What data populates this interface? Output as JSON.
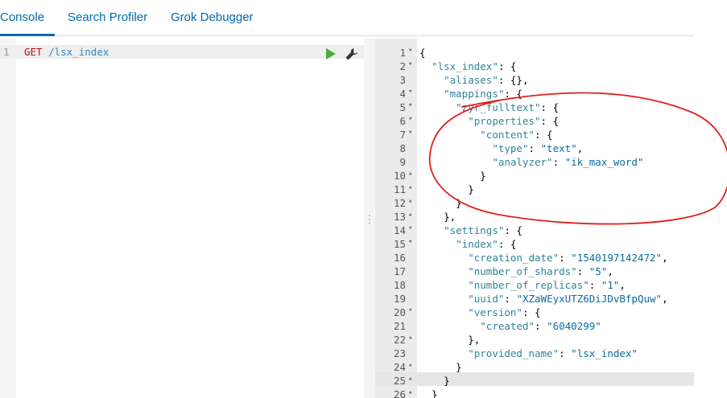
{
  "tabs": [
    {
      "label": "Console"
    },
    {
      "label": "Search Profiler"
    },
    {
      "label": "Grok Debugger"
    }
  ],
  "request": {
    "line_number": "1",
    "method": "GET",
    "path": "/lsx_index"
  },
  "colors": {
    "accent": "#006bb4",
    "method": "#c80a0a",
    "url": "#2b8fc6",
    "run": "#4aad3b",
    "annotation": "#e0201b"
  },
  "response": {
    "lines": [
      {
        "n": "1",
        "fold": "▾",
        "text": "{"
      },
      {
        "n": "2",
        "fold": "▾",
        "text": "  \"lsx_index\": {"
      },
      {
        "n": "3",
        "fold": "",
        "text": "    \"aliases\": {},"
      },
      {
        "n": "4",
        "fold": "▾",
        "text": "    \"mappings\": {"
      },
      {
        "n": "5",
        "fold": "▾",
        "text": "      \"zyr_fulltext\": {"
      },
      {
        "n": "6",
        "fold": "▾",
        "text": "        \"properties\": {"
      },
      {
        "n": "7",
        "fold": "▾",
        "text": "          \"content\": {"
      },
      {
        "n": "8",
        "fold": "",
        "text": "            \"type\": \"text\","
      },
      {
        "n": "9",
        "fold": "",
        "text": "            \"analyzer\": \"ik_max_word\""
      },
      {
        "n": "10",
        "fold": "▴",
        "text": "          }"
      },
      {
        "n": "11",
        "fold": "▴",
        "text": "        }"
      },
      {
        "n": "12",
        "fold": "▴",
        "text": "      }"
      },
      {
        "n": "13",
        "fold": "▴",
        "text": "    },"
      },
      {
        "n": "14",
        "fold": "▾",
        "text": "    \"settings\": {"
      },
      {
        "n": "15",
        "fold": "▾",
        "text": "      \"index\": {"
      },
      {
        "n": "16",
        "fold": "",
        "text": "        \"creation_date\": \"1540197142472\","
      },
      {
        "n": "17",
        "fold": "",
        "text": "        \"number_of_shards\": \"5\","
      },
      {
        "n": "18",
        "fold": "",
        "text": "        \"number_of_replicas\": \"1\","
      },
      {
        "n": "19",
        "fold": "",
        "text": "        \"uuid\": \"XZaWEyxUTZ6DiJDvBfpQuw\","
      },
      {
        "n": "20",
        "fold": "▾",
        "text": "        \"version\": {"
      },
      {
        "n": "21",
        "fold": "",
        "text": "          \"created\": \"6040299\""
      },
      {
        "n": "22",
        "fold": "▴",
        "text": "        },"
      },
      {
        "n": "23",
        "fold": "",
        "text": "        \"provided_name\": \"lsx_index\""
      },
      {
        "n": "24",
        "fold": "▴",
        "text": "      }"
      },
      {
        "n": "25",
        "fold": "▴",
        "text": "    }"
      },
      {
        "n": "26",
        "fold": "▴",
        "text": "  }"
      }
    ]
  }
}
